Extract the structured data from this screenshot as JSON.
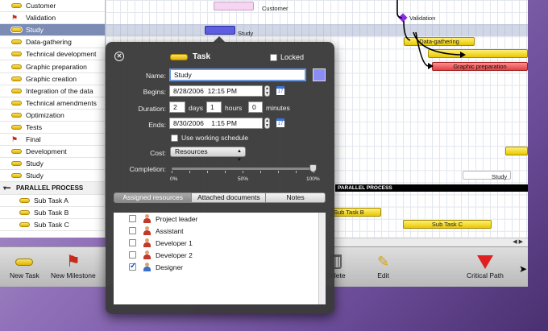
{
  "task_list": {
    "rows": [
      {
        "label": "Customer",
        "kind": "task"
      },
      {
        "label": "Validation",
        "kind": "milestone"
      },
      {
        "label": "Study",
        "kind": "task",
        "selected": true
      },
      {
        "label": "Data-gathering",
        "kind": "task"
      },
      {
        "label": "Technical development",
        "kind": "task"
      },
      {
        "label": "Graphic preparation",
        "kind": "task"
      },
      {
        "label": "Graphic creation",
        "kind": "task"
      },
      {
        "label": "Integration of the data",
        "kind": "task"
      },
      {
        "label": "Technical amendments",
        "kind": "task"
      },
      {
        "label": "Optimization",
        "kind": "task"
      },
      {
        "label": "Tests",
        "kind": "task"
      },
      {
        "label": "Final",
        "kind": "milestone"
      },
      {
        "label": "Development",
        "kind": "task"
      },
      {
        "label": "Study",
        "kind": "task"
      },
      {
        "label": "Study",
        "kind": "task"
      },
      {
        "label": "PARALLEL PROCESS",
        "kind": "group"
      },
      {
        "label": "Sub Task A",
        "kind": "subtask"
      },
      {
        "label": "Sub Task B",
        "kind": "subtask"
      },
      {
        "label": "Sub Task C",
        "kind": "subtask"
      }
    ]
  },
  "chart": {
    "labels": {
      "customer": "Customer",
      "study": "Study",
      "validation": "Validation",
      "data_gathering": "Data-gathering",
      "graphic_preparation": "Graphic preparation",
      "study_lower": "Study",
      "parallel_process": "PARALLEL PROCESS",
      "sub_task_b": "Sub Task B",
      "sub_task_c": "Sub Task C"
    }
  },
  "toolbar": {
    "new_task": "New Task",
    "new_milestone": "New Milestone",
    "delete": "Delete",
    "edit": "Edit",
    "critical_path": "Critical Path"
  },
  "inspector": {
    "title": "Task",
    "locked_label": "Locked",
    "name_label": "Name:",
    "name_value": "Study",
    "color": "#8b8cf4",
    "begins_label": "Begins:",
    "begins_date": "8/28/2006",
    "begins_time": "12:15 PM",
    "duration_label": "Duration:",
    "duration_days": "2",
    "days_unit": "days",
    "duration_hours": "1",
    "hours_unit": "hours",
    "duration_minutes": "0",
    "minutes_unit": "minutes",
    "ends_label": "Ends:",
    "ends_date": "8/30/2006",
    "ends_time": "1:15 PM",
    "use_working_schedule": "Use working schedule",
    "cost_label": "Cost:",
    "cost_value": "Resources",
    "completion_label": "Completion:",
    "completion_fraction": 1.0,
    "completion_ticks": [
      "0%",
      "50%",
      "100%"
    ],
    "calendar_glyph": "17",
    "tabs": [
      "Assigned resources",
      "Attached documents",
      "Notes"
    ],
    "resources": [
      {
        "name": "Project leader",
        "checked": false
      },
      {
        "name": "Assistant",
        "checked": false
      },
      {
        "name": "Developer 1",
        "checked": false
      },
      {
        "name": "Developer 2",
        "checked": false
      },
      {
        "name": "Designer",
        "checked": true
      }
    ]
  }
}
